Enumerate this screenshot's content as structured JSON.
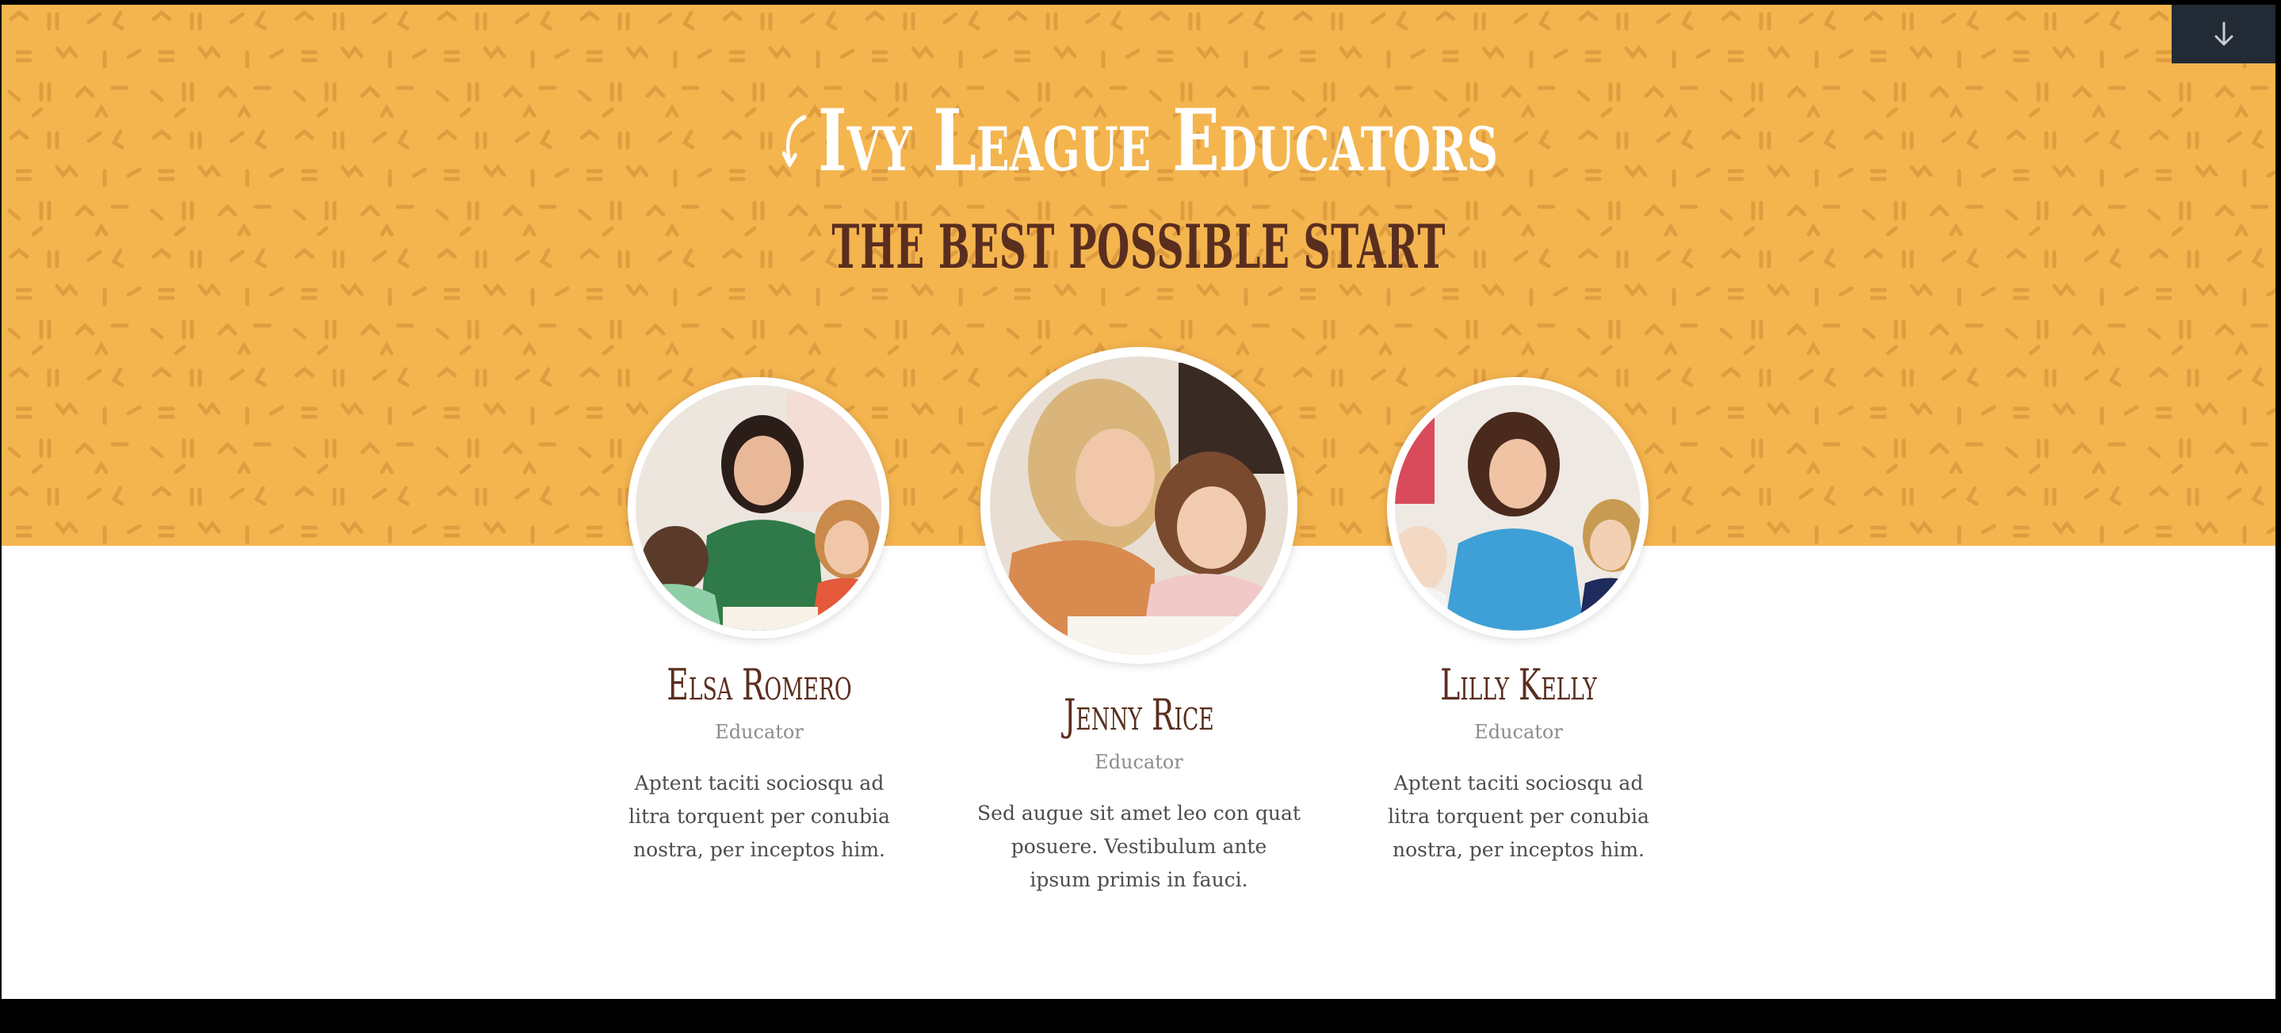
{
  "hero": {
    "title": "Ivy League Educators",
    "subtitle": "THE BEST POSSIBLE START",
    "background_color": "#f4b54f",
    "title_color": "#ffffff",
    "subtitle_color": "#5a2e1f",
    "title_icon": "curved-arrow-icon"
  },
  "scroll_button": {
    "icon": "arrow-down-icon",
    "background_color": "#222b35"
  },
  "team": [
    {
      "name": "Elsa Romero",
      "role": "Educator",
      "bio_lines": [
        "Aptent taciti sociosqu ad",
        "litra torquent per conubia",
        "nostra, per inceptos him."
      ]
    },
    {
      "name": "Jenny Rice",
      "role": "Educator",
      "bio_lines": [
        "Sed augue sit amet leo con quat",
        "posuere. Vestibulum ante",
        "ipsum primis in fauci."
      ]
    },
    {
      "name": "Lilly Kelly",
      "role": "Educator",
      "bio_lines": [
        "Aptent taciti sociosqu ad",
        "litra torquent per conubia",
        "nostra, per inceptos him."
      ]
    }
  ]
}
